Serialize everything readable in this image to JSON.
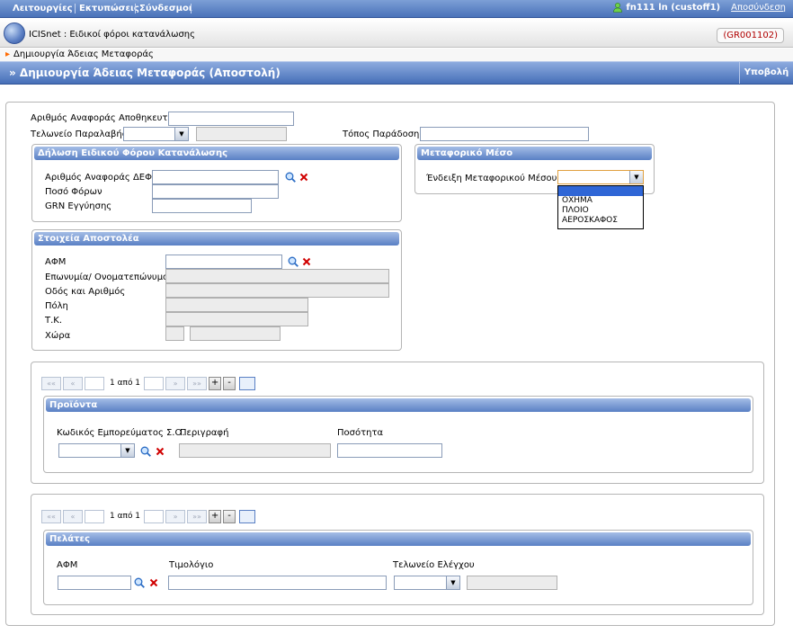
{
  "menubar": {
    "items": [
      "Λειτουργίες",
      "Εκτυπώσεις",
      "Σύνδεσμοι"
    ],
    "user": "fn111 ln (custoff1)",
    "logout": "Αποσύνδεση"
  },
  "header": {
    "app_title": "ICISnet : Ειδικοί φόροι κατανάλωσης",
    "code": "(GR001102)"
  },
  "breadcrumb": "Δημιουργία Άδειας Μεταφοράς",
  "page": {
    "title": "» Δημιουργία Άδειας Μεταφοράς (Αποστολή)",
    "submit": "Υποβολή"
  },
  "form": {
    "receiver_ref_label": "Αριθμός Αναφοράς Αποθηκευτή",
    "receiver_ref_value": "",
    "customs_receipt_label": "Τελωνείο Παραλαβής",
    "customs_receipt_value": "",
    "delivery_place_label": "Τόπος Παράδοσης",
    "delivery_place_value": ""
  },
  "excise_declaration": {
    "title": "Δήλωση Ειδικού Φόρου Κατανάλωσης",
    "ref_label": "Αριθμός Αναφοράς ΔΕΦΚ",
    "ref_value": "",
    "tax_amount_label": "Ποσό Φόρων",
    "tax_amount_value": "",
    "grn_label": "GRN Εγγύησης",
    "grn_value": ""
  },
  "transport": {
    "title": "Μεταφορικό Μέσο",
    "indication_label": "Ένδειξη Μεταφορικού Μέσου",
    "selected": "",
    "options": [
      "",
      "ΟΧΗΜΑ",
      "ΠΛΟΙΟ",
      "ΑΕΡΟΣΚΑΦΟΣ"
    ]
  },
  "sender": {
    "title": "Στοιχεία Αποστολέα",
    "afm_label": "ΑΦΜ",
    "name_label": "Επωνυμία/ Ονοματεπώνυμο",
    "street_label": "Οδός και Αριθμός",
    "city_label": "Πόλη",
    "postcode_label": "Τ.Κ.",
    "country_label": "Χώρα"
  },
  "products": {
    "pager_text": "1 από 1",
    "title": "Προϊόντα",
    "code_label": "Κωδικός Εμπορεύματος Σ.Ο.",
    "desc_label": "Περιγραφή",
    "qty_label": "Ποσότητα"
  },
  "customers": {
    "pager_text": "1 από 1",
    "title": "Πελάτες",
    "afm_label": "ΑΦΜ",
    "invoice_label": "Τιμολόγιο",
    "control_office_label": "Τελωνείο Ελέγχου"
  },
  "pager_glyphs": {
    "first": "««",
    "prev": "«",
    "next": "»",
    "last": "»»",
    "add": "+",
    "remove": "-"
  }
}
